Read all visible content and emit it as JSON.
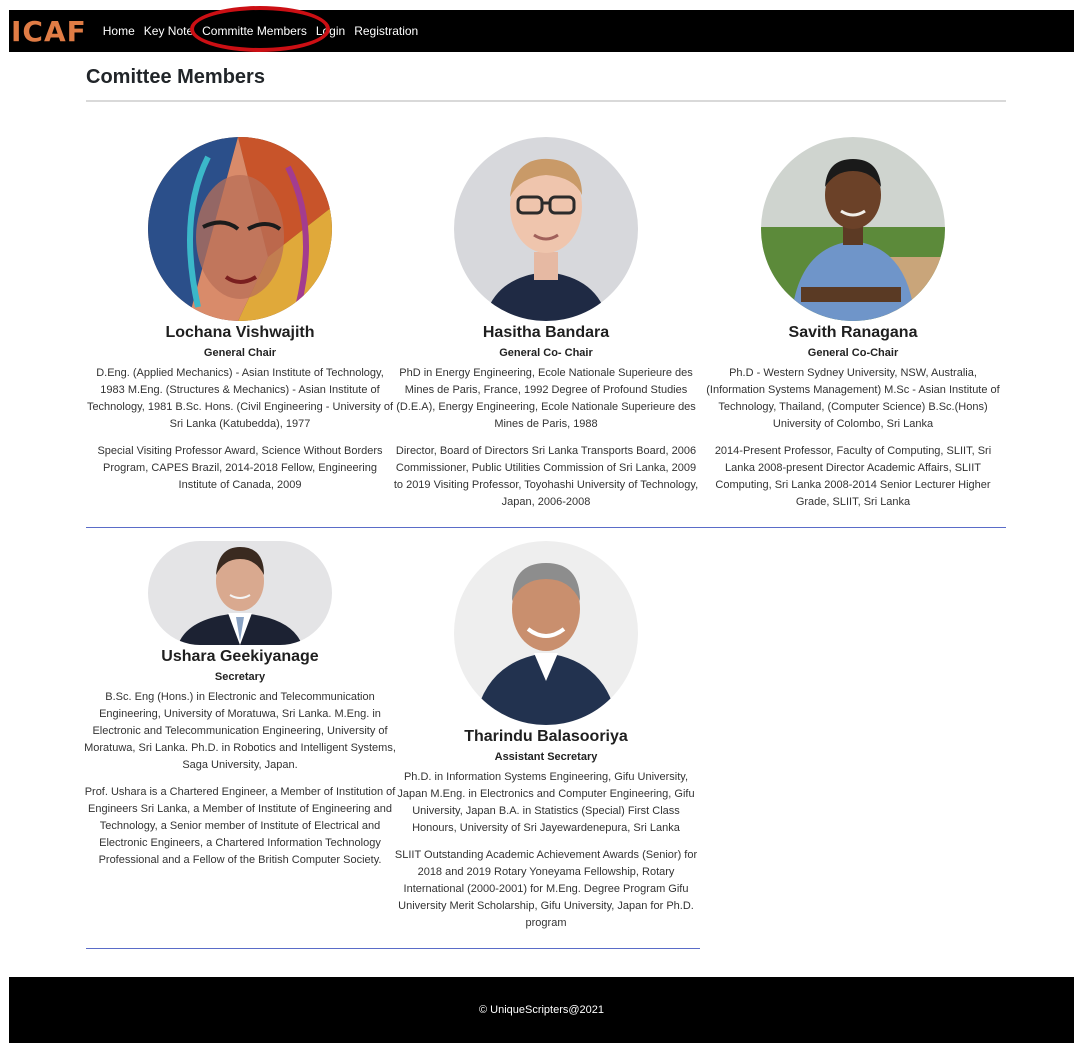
{
  "brand": "ICAF",
  "nav": {
    "items": [
      "Home",
      "Key Note",
      "Committe Members",
      "Login",
      "Registration"
    ]
  },
  "page": {
    "title": "Comittee Members"
  },
  "members": [
    {
      "name": "Lochana Vishwajith",
      "role": "General Chair",
      "education": "D.Eng. (Applied Mechanics) - Asian Institute of Technology, 1983 M.Eng. (Structures & Mechanics) - Asian Institute of Technology, 1981 B.Sc. Hons. (Civil Engineering - University of Sri Lanka (Katubedda), 1977",
      "experience": "Special Visiting Professor Award, Science Without Borders Program, CAPES Brazil, 2014-2018 Fellow, Engineering Institute of Canada, 2009"
    },
    {
      "name": "Hasitha Bandara",
      "role": "General Co- Chair",
      "education": "PhD in Energy Engineering, Ecole Nationale Superieure des Mines de Paris, France, 1992 Degree of Profound Studies (D.E.A), Energy Engineering, Ecole Nationale Superieure des Mines de Paris, 1988",
      "experience": "Director, Board of Directors Sri Lanka Transports Board, 2006 Commissioner, Public Utilities Commission of Sri Lanka, 2009 to 2019 Visiting Professor, Toyohashi University of Technology, Japan, 2006-2008"
    },
    {
      "name": "Savith Ranagana",
      "role": "General Co-Chair",
      "education": "Ph.D - Western Sydney University, NSW, Australia, (Information Systems Management) M.Sc - Asian Institute of Technology, Thailand, (Computer Science) B.Sc.(Hons) University of Colombo, Sri Lanka",
      "experience": "2014-Present Professor, Faculty of Computing, SLIIT, Sri Lanka 2008-present Director Academic Affairs, SLIIT Computing, Sri Lanka 2008-2014 Senior Lecturer Higher Grade, SLIIT, Sri Lanka"
    },
    {
      "name": "Ushara Geekiyanage",
      "role": "Secretary",
      "education": "B.Sc. Eng (Hons.) in Electronic and Telecommunication Engineering, University of Moratuwa, Sri Lanka. M.Eng. in Electronic and Telecommunication Engineering, University of Moratuwa, Sri Lanka. Ph.D. in Robotics and Intelligent Systems, Saga University, Japan.",
      "experience": "Prof. Ushara is a Chartered Engineer, a Member of Institution of Engineers Sri Lanka, a Member of Institute of Engineering and Technology, a Senior member of Institute of Electrical and Electronic Engineers, a Chartered Information Technology Professional and a Fellow of the British Computer Society."
    },
    {
      "name": "Tharindu Balasooriya",
      "role": "Assistant Secretary",
      "education": "Ph.D. in Information Systems Engineering, Gifu University, Japan M.Eng. in Electronics and Computer Engineering, Gifu University, Japan B.A. in Statistics (Special) First Class Honours, University of Sri Jayewardenepura, Sri Lanka",
      "experience": "SLIIT Outstanding Academic Achievement Awards (Senior) for 2018 and 2019 Rotary Yoneyama Fellowship, Rotary International (2000-2001) for M.Eng. Degree Program Gifu University Merit Scholarship, Gifu University, Japan for Ph.D. program"
    }
  ],
  "footer": {
    "copyright": "© UniqueScripters@2021"
  },
  "colors": {
    "brand": "#e07c45",
    "highlight": "#cc0f14",
    "divider": "#5a6cc8"
  }
}
